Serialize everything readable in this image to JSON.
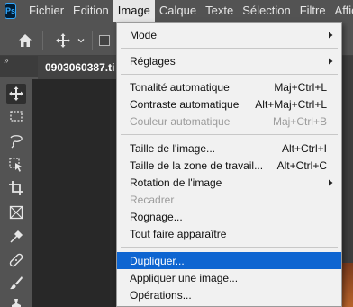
{
  "app": {
    "logo_text": "Ps"
  },
  "menubar": {
    "items": [
      "Fichier",
      "Edition",
      "Image",
      "Calque",
      "Texte",
      "Sélection",
      "Filtre",
      "Affich"
    ],
    "active_index": 2
  },
  "document": {
    "tab_title": "0903060387.ti"
  },
  "image_menu": {
    "items": [
      {
        "label": "Mode",
        "shortcut": "",
        "submenu": true,
        "disabled": false
      },
      {
        "label": "Réglages",
        "shortcut": "",
        "submenu": true,
        "disabled": false
      },
      {
        "label": "Tonalité automatique",
        "shortcut": "Maj+Ctrl+L",
        "submenu": false,
        "disabled": false
      },
      {
        "label": "Contraste automatique",
        "shortcut": "Alt+Maj+Ctrl+L",
        "submenu": false,
        "disabled": false
      },
      {
        "label": "Couleur automatique",
        "shortcut": "Maj+Ctrl+B",
        "submenu": false,
        "disabled": true
      },
      {
        "label": "Taille de l'image...",
        "shortcut": "Alt+Ctrl+I",
        "submenu": false,
        "disabled": false
      },
      {
        "label": "Taille de la zone de travail...",
        "shortcut": "Alt+Ctrl+C",
        "submenu": false,
        "disabled": false
      },
      {
        "label": "Rotation de l'image",
        "shortcut": "",
        "submenu": true,
        "disabled": false
      },
      {
        "label": "Recadrer",
        "shortcut": "",
        "submenu": false,
        "disabled": true
      },
      {
        "label": "Rognage...",
        "shortcut": "",
        "submenu": false,
        "disabled": false
      },
      {
        "label": "Tout faire apparaître",
        "shortcut": "",
        "submenu": false,
        "disabled": false
      },
      {
        "label": "Dupliquer...",
        "shortcut": "",
        "submenu": false,
        "disabled": false,
        "highlighted": true
      },
      {
        "label": "Appliquer une image...",
        "shortcut": "",
        "submenu": false,
        "disabled": false
      },
      {
        "label": "Opérations...",
        "shortcut": "",
        "submenu": false,
        "disabled": false
      }
    ]
  },
  "tools": [
    {
      "name": "move-tool-icon",
      "selected": true
    },
    {
      "name": "marquee-tool-icon"
    },
    {
      "name": "lasso-tool-icon"
    },
    {
      "name": "object-selection-tool-icon"
    },
    {
      "name": "crop-tool-icon"
    },
    {
      "name": "frame-tool-icon"
    },
    {
      "name": "eyedropper-tool-icon"
    },
    {
      "name": "healing-brush-tool-icon"
    },
    {
      "name": "brush-tool-icon"
    },
    {
      "name": "clone-stamp-tool-icon"
    }
  ],
  "colors": {
    "highlight": "#0e65d1",
    "menu_bg": "#f1f1f1",
    "app_bg": "#535353"
  }
}
